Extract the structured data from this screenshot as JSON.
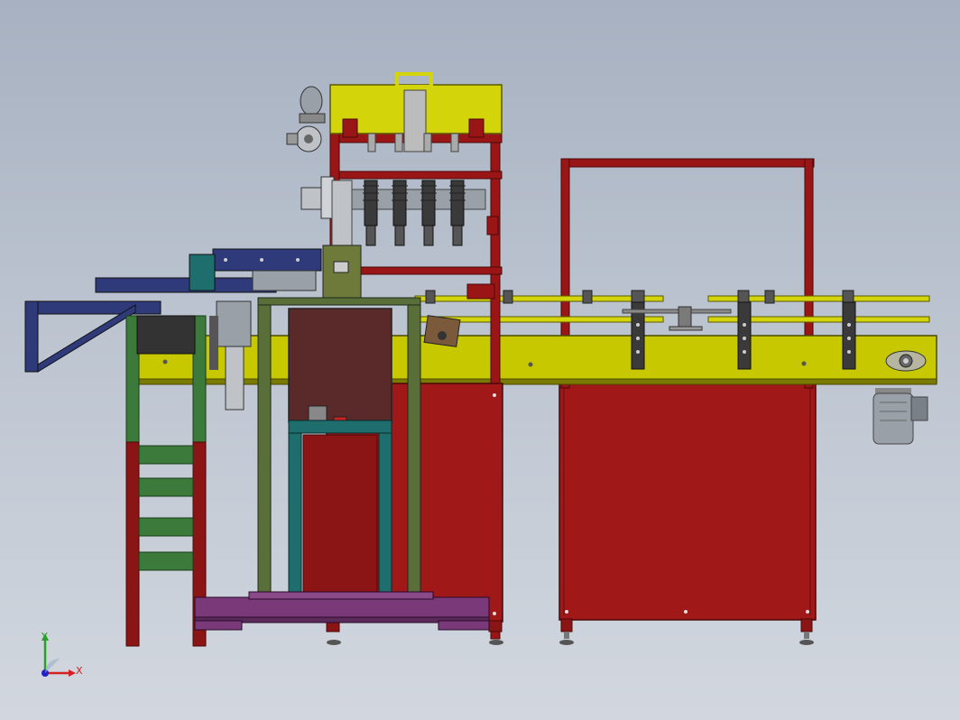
{
  "viewport": {
    "background_top": "#a7b1c1",
    "background_bottom": "#d2d7df"
  },
  "model_colors": {
    "frame_red": "#8b1414",
    "cabinet_red": "#a01818",
    "hopper_yellow": "#d4d40a",
    "conveyor_yellow": "#c8c800",
    "ladder_green": "#3c7a3c",
    "teal_frame": "#1e6e6e",
    "olive_frame": "#5a6e3a",
    "navy_structure": "#2e3a7a",
    "gray_steel": "#9aa0a8",
    "purple_base": "#7a3a7a",
    "brown_panel": "#5a2a2a"
  },
  "triad": {
    "y_label": "Y",
    "x_label": "X",
    "y_color": "#2aa02a",
    "x_color": "#d42020",
    "z_color": "#2020c8"
  }
}
